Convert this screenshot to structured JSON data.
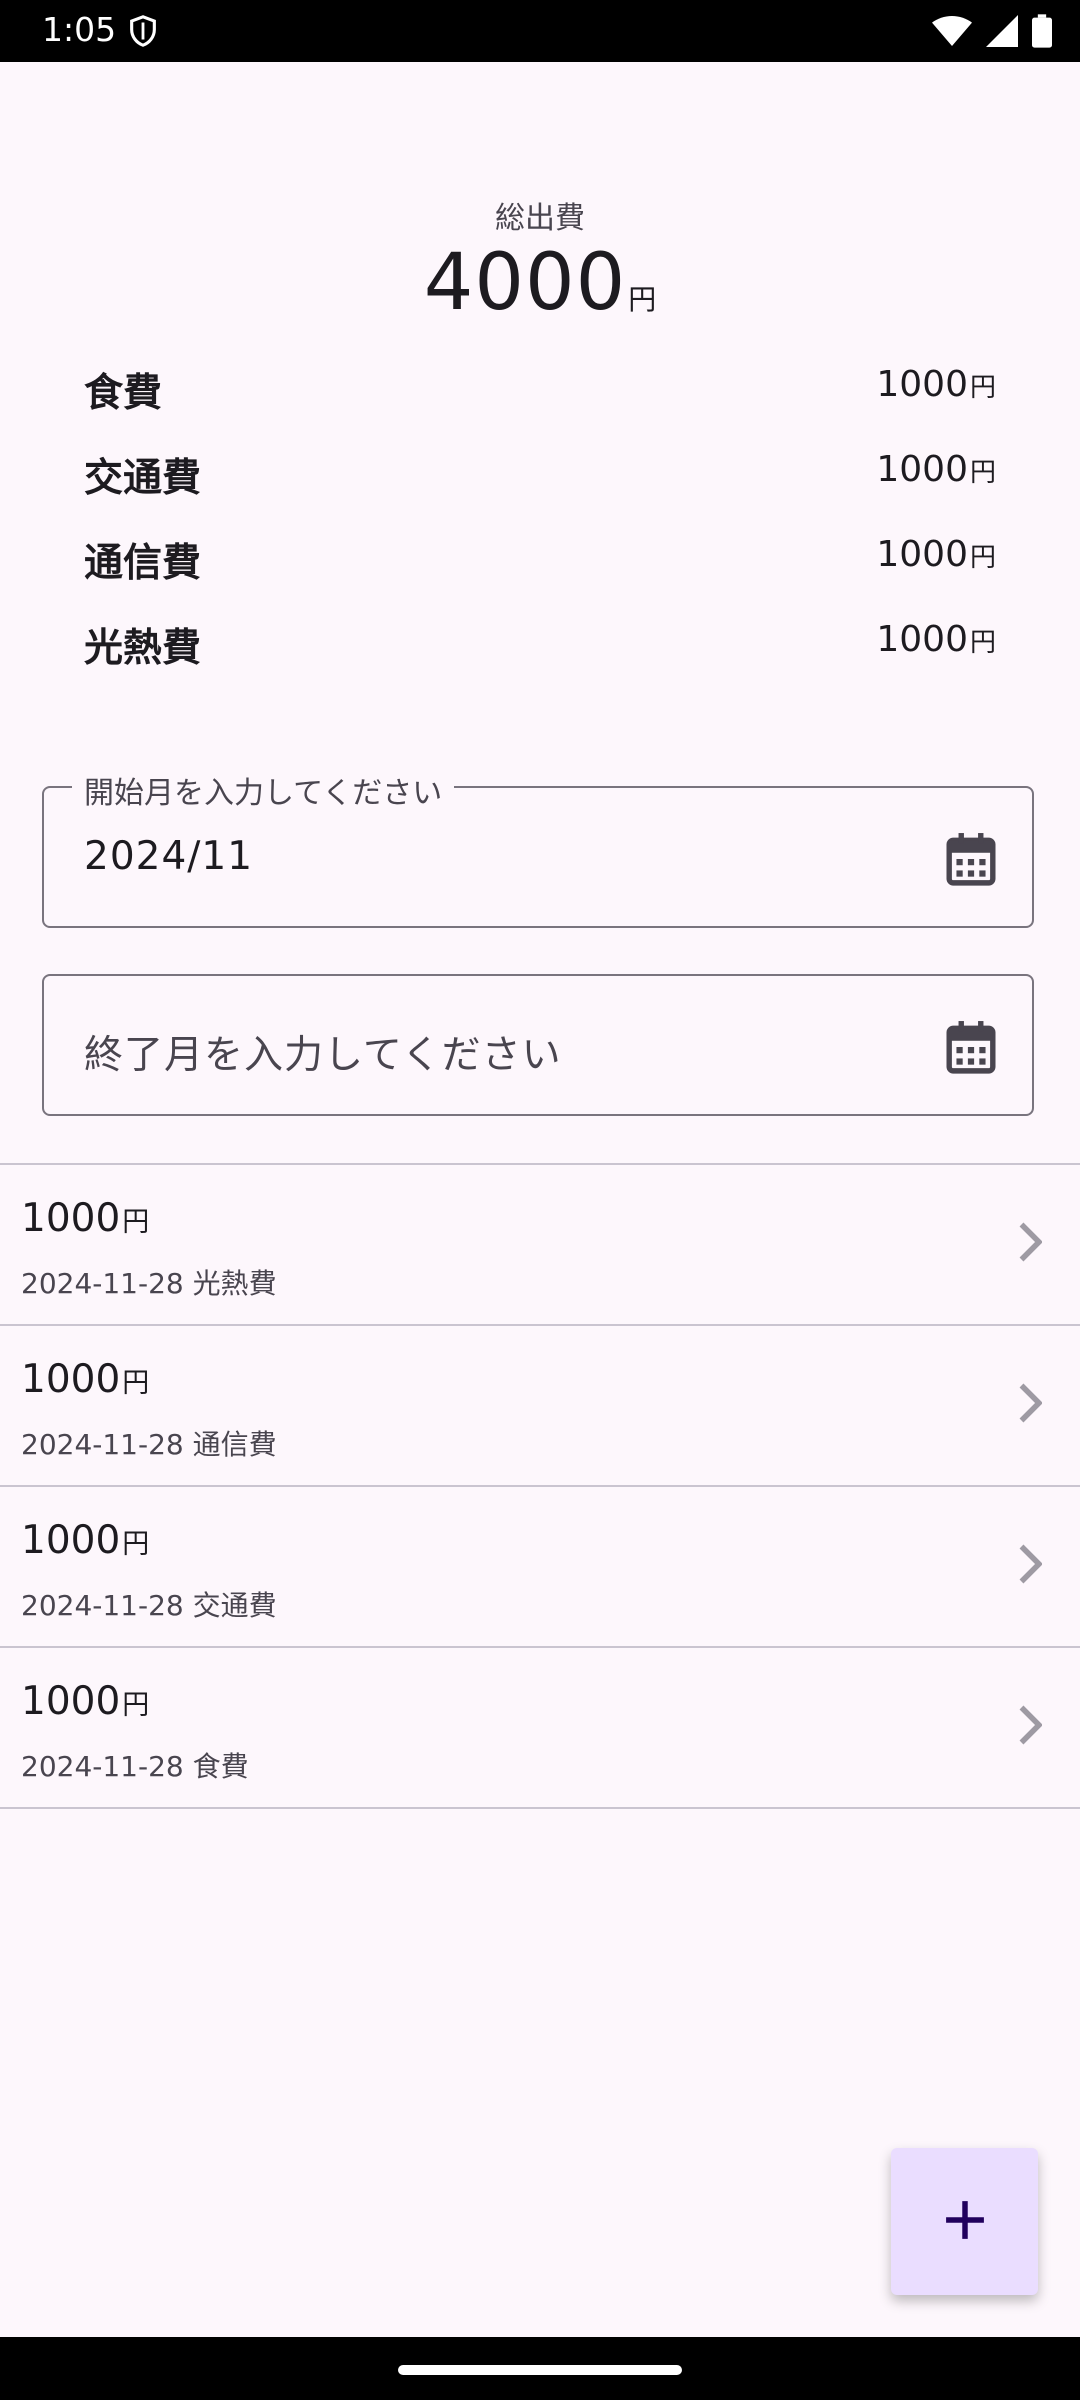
{
  "status_bar": {
    "time": "1:05"
  },
  "summary": {
    "label": "総出費",
    "total": "4000",
    "unit": "円"
  },
  "categories": [
    {
      "name": "食費",
      "amount": "1000",
      "unit": "円"
    },
    {
      "name": "交通費",
      "amount": "1000",
      "unit": "円"
    },
    {
      "name": "通信費",
      "amount": "1000",
      "unit": "円"
    },
    {
      "name": "光熱費",
      "amount": "1000",
      "unit": "円"
    }
  ],
  "start_field": {
    "label": "開始月を入力してください",
    "value": "2024/11"
  },
  "end_field": {
    "placeholder": "終了月を入力してください"
  },
  "expenses": [
    {
      "amount": "1000",
      "unit": "円",
      "detail": "2024-11-28 光熱費"
    },
    {
      "amount": "1000",
      "unit": "円",
      "detail": "2024-11-28 通信費"
    },
    {
      "amount": "1000",
      "unit": "円",
      "detail": "2024-11-28 交通費"
    },
    {
      "amount": "1000",
      "unit": "円",
      "detail": "2024-11-28 食費"
    }
  ],
  "fab": {
    "icon": "plus-icon",
    "color": "#eaddff"
  }
}
